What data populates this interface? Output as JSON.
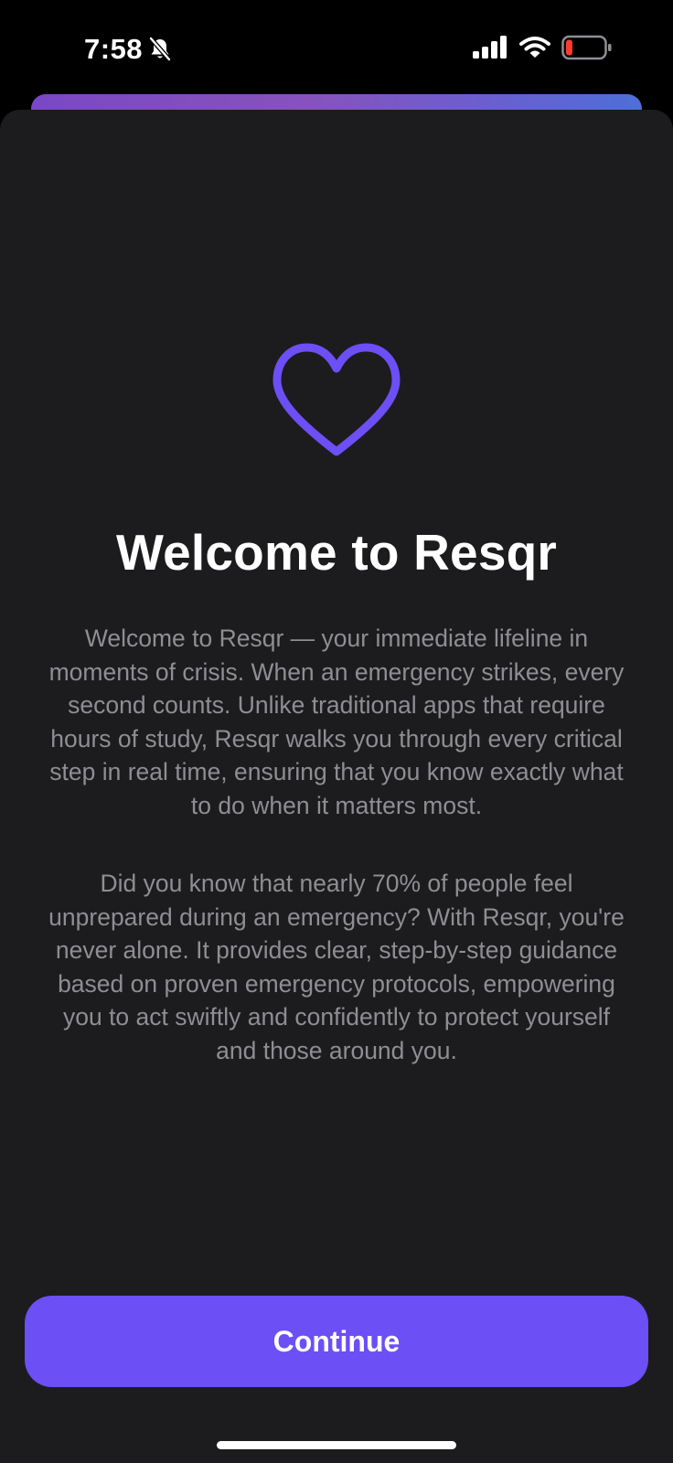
{
  "status_bar": {
    "time": "7:58",
    "icons": [
      "bell-slash-icon",
      "signal-icon",
      "wifi-icon",
      "battery-icon"
    ],
    "battery_color": "#ff3b30"
  },
  "welcome": {
    "icon": "heart-icon",
    "accent_color": "#6c4ff5",
    "title": "Welcome to Resqr",
    "paragraph_1": "Welcome to Resqr — your immediate lifeline in moments of crisis. When an emergency strikes, every second counts. Unlike traditional apps that require hours of study, Resqr walks you through every critical step in real time, ensuring that you know exactly what to do when it matters most.",
    "paragraph_2": "Did you know that nearly 70% of people feel unprepared during an emergency? With Resqr, you're never alone. It provides clear, step-by-step guidance based on proven emergency protocols, empowering you to act swiftly and confidently to protect yourself and those around you."
  },
  "actions": {
    "continue_label": "Continue"
  }
}
